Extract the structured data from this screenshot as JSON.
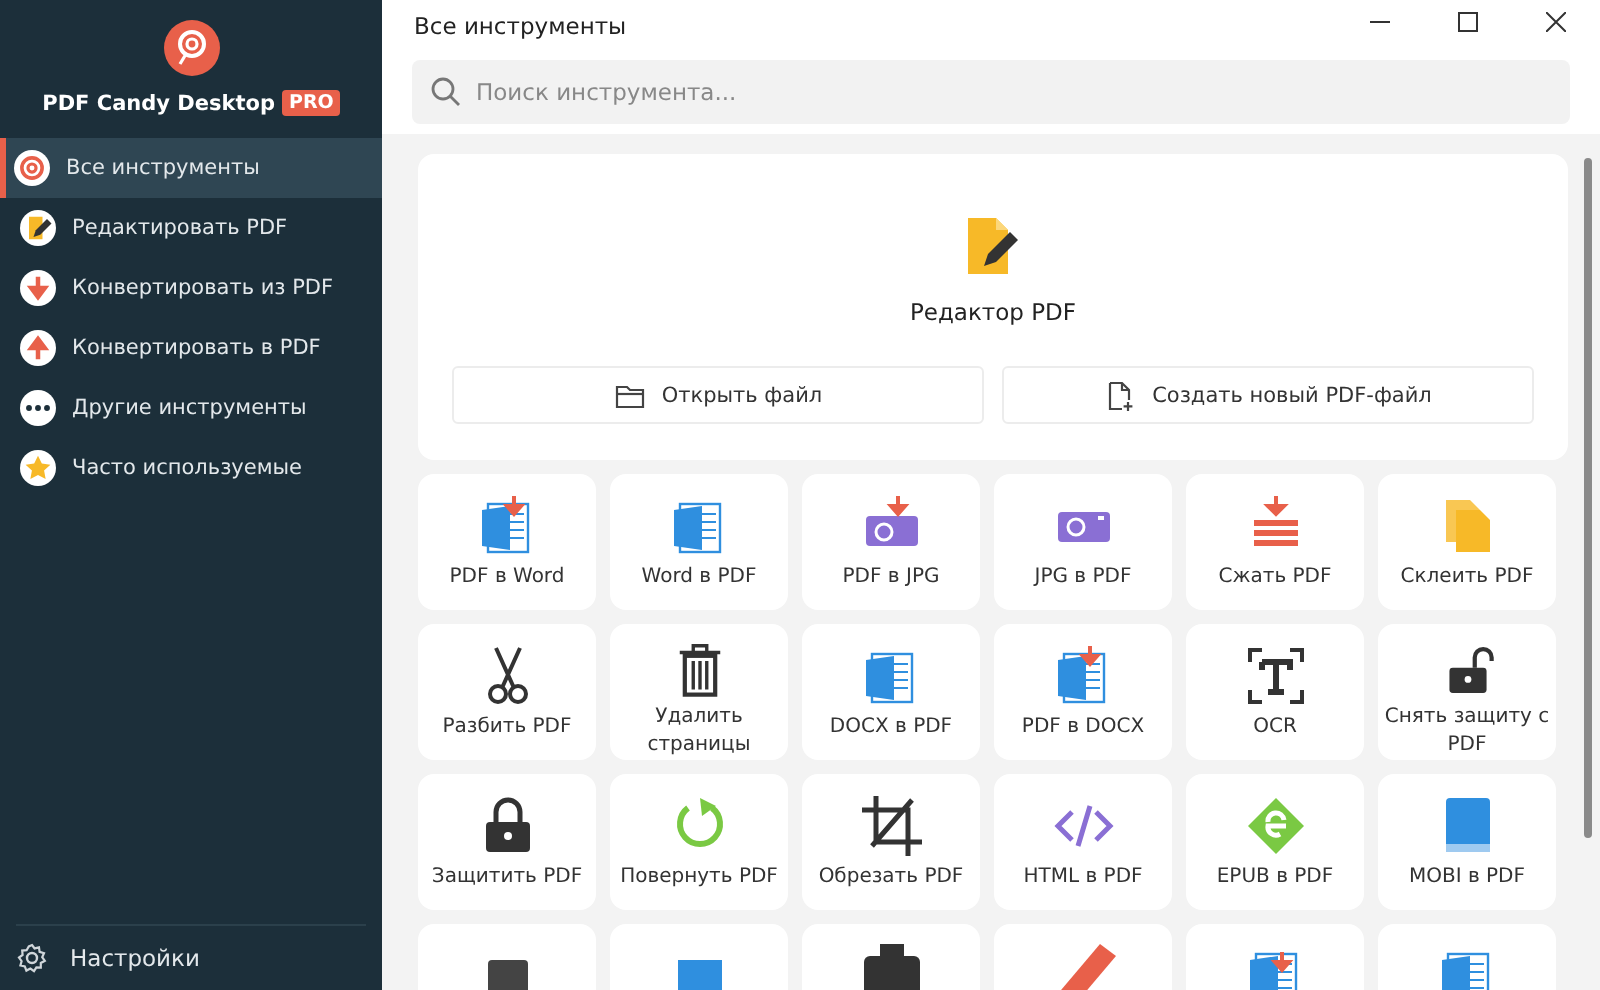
{
  "app": {
    "name": "PDF Candy Desktop",
    "badge": "PRO"
  },
  "sidebar": {
    "items": [
      {
        "label": "Все инструменты",
        "selected": true
      },
      {
        "label": "Редактировать PDF",
        "selected": false
      },
      {
        "label": "Конвертировать из PDF",
        "selected": false
      },
      {
        "label": "Конвертировать в PDF",
        "selected": false
      },
      {
        "label": "Другие инструменты",
        "selected": false
      },
      {
        "label": "Часто используемые",
        "selected": false
      }
    ],
    "settings": "Настройки"
  },
  "window": {
    "title": "Все инструменты"
  },
  "search": {
    "placeholder": "Поиск инструмента..."
  },
  "editor": {
    "title": "Редактор PDF",
    "buttons": [
      "Открыть файл",
      "Создать новый PDF-файл"
    ]
  },
  "tools": [
    {
      "label": "PDF в Word"
    },
    {
      "label": "Word в PDF"
    },
    {
      "label": "PDF в JPG"
    },
    {
      "label": "JPG в PDF"
    },
    {
      "label": "Сжать PDF"
    },
    {
      "label": "Склеить PDF"
    },
    {
      "label": "Разбить PDF"
    },
    {
      "label": "Удалить страницы"
    },
    {
      "label": "DOCX в PDF"
    },
    {
      "label": "PDF в DOCX"
    },
    {
      "label": "OCR"
    },
    {
      "label": "Снять защиту с PDF"
    },
    {
      "label": "Защитить PDF"
    },
    {
      "label": "Повернуть PDF"
    },
    {
      "label": "Обрезать PDF"
    },
    {
      "label": "HTML в PDF"
    },
    {
      "label": "EPUB в PDF"
    },
    {
      "label": "MOBI в PDF"
    }
  ],
  "more_tools_below": true
}
